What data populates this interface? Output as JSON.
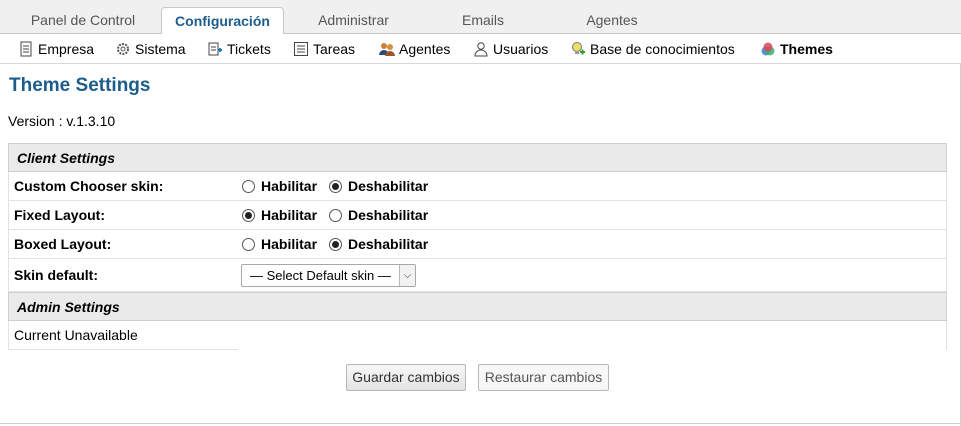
{
  "tabs": [
    {
      "label": "Panel de Control",
      "active": false
    },
    {
      "label": "Configuración",
      "active": true
    },
    {
      "label": "Administrar",
      "active": false
    },
    {
      "label": "Emails",
      "active": false
    },
    {
      "label": "Agentes",
      "active": false
    }
  ],
  "subnav": [
    {
      "label": "Empresa",
      "icon": "document-icon"
    },
    {
      "label": "Sistema",
      "icon": "gear-icon"
    },
    {
      "label": "Tickets",
      "icon": "ticket-icon"
    },
    {
      "label": "Tareas",
      "icon": "list-icon"
    },
    {
      "label": "Agentes",
      "icon": "agents-icon"
    },
    {
      "label": "Usuarios",
      "icon": "user-icon"
    },
    {
      "label": "Base de conocimientos",
      "icon": "knowledgebase-icon"
    },
    {
      "label": "Themes",
      "icon": "themes-icon",
      "active": true
    }
  ],
  "page": {
    "title": "Theme Settings",
    "version": "Version : v.1.3.10"
  },
  "client_settings": {
    "heading": "Client Settings",
    "custom_chooser": {
      "label": "Custom Chooser skin:",
      "opt1": "Habilitar",
      "opt2": "Deshabilitar",
      "selected": "Deshabilitar"
    },
    "fixed_layout": {
      "label": "Fixed Layout:",
      "opt1": "Habilitar",
      "opt2": "Deshabilitar",
      "selected": "Habilitar"
    },
    "boxed_layout": {
      "label": "Boxed Layout:",
      "opt1": "Habilitar",
      "opt2": "Deshabilitar",
      "selected": "Deshabilitar"
    },
    "skin_default": {
      "label": "Skin default:",
      "value": "— Select Default skin —"
    }
  },
  "admin_settings": {
    "heading": "Admin Settings",
    "current": "Current Unavailable"
  },
  "buttons": {
    "save": "Guardar cambios",
    "reset": "Restaurar cambios"
  },
  "colors": {
    "title": "#1d5d8c",
    "active_tab": "#1d5d8c"
  }
}
